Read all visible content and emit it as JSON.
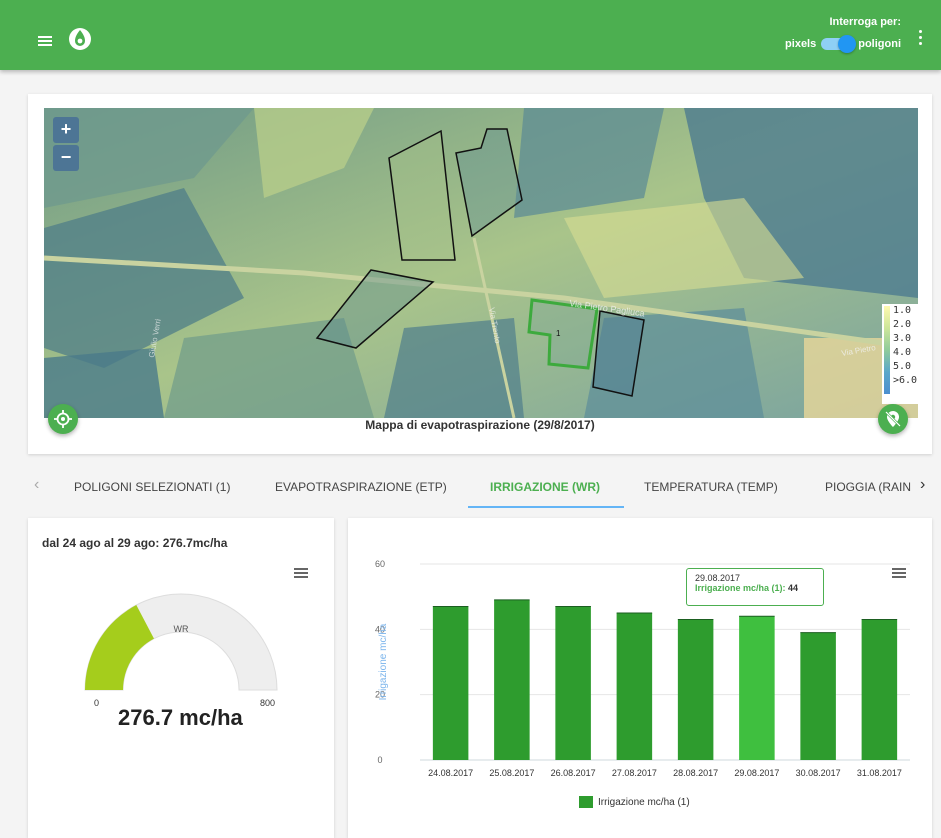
{
  "header": {
    "interroga_label": "Interroga per:",
    "pixels_label": "pixels",
    "poligoni_label": "poligoni"
  },
  "map": {
    "zoom_in": "+",
    "zoom_out": "−",
    "legend": [
      "1.0",
      "2.0",
      "3.0",
      "4.0",
      "5.0",
      ">6.0"
    ],
    "caption": "Mappa di evapotraspirazione (29/8/2017)",
    "polygon_label": "1",
    "road_label_1": "Via Pietro Pagliuca",
    "road_label_2": "Via Trento",
    "road_label_3": "Via Pietro",
    "road_label_4": "Giulio Verri"
  },
  "tabs": {
    "prev_arrow": "‹",
    "next_arrow": "›",
    "items": [
      "POLIGONI SELEZIONATI (1)",
      "EVAPOTRASPIRAZIONE (ETP)",
      "IRRIGAZIONE (WR)",
      "TEMPERATURA (TEMP)",
      "PIOGGIA (RAIN"
    ]
  },
  "gauge": {
    "title": "dal 24 ago al 29 ago: 276.7mc/ha",
    "label": "WR",
    "min": "0",
    "max": "800",
    "value_text": "276.7 mc/ha",
    "value": 276.7,
    "range": [
      0,
      800
    ],
    "fill_color": "#a5cd1c",
    "track_color": "#eeeeee"
  },
  "chart_data": {
    "type": "bar",
    "categories": [
      "24.08.2017",
      "25.08.2017",
      "26.08.2017",
      "27.08.2017",
      "28.08.2017",
      "29.08.2017",
      "30.08.2017",
      "31.08.2017"
    ],
    "series": [
      {
        "name": "Irrigazione mc/ha (1)",
        "values": [
          47,
          49,
          47,
          45,
          43,
          44,
          39,
          43
        ]
      }
    ],
    "ylabel": "Irrigazione mc/ha",
    "yticks": [
      "0",
      "20",
      "40",
      "60"
    ],
    "ylim": [
      0,
      60
    ],
    "highlight_index": 5,
    "bar_color": "#2e9c2e",
    "highlight_color": "#3fbf3f",
    "tooltip": {
      "date": "29.08.2017",
      "series": "Irrigazione mc/ha (1)",
      "value": "44"
    }
  }
}
